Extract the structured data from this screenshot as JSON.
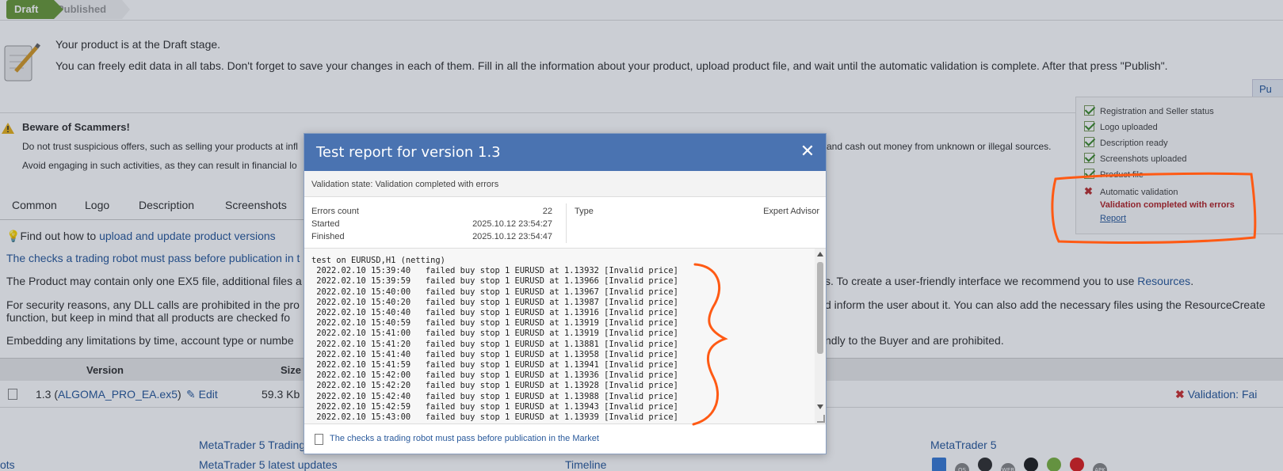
{
  "stages": {
    "draft": "Draft",
    "published": "Published"
  },
  "info": {
    "line1": "Your product is at the Draft stage.",
    "line2": "You can freely edit data in all tabs. Don't forget to save your changes in each of them. Fill in all the information about your product, upload product file, and wait until the automatic validation is complete. After that press \"Publish\"."
  },
  "publish_button": "Pu",
  "checklist": {
    "items": [
      "Registration and Seller status",
      "Logo uploaded",
      "Description ready",
      "Screenshots uploaded",
      "Product file"
    ],
    "auto_validation": "Automatic validation",
    "validation_error": "Validation completed with errors",
    "report_link": "Report"
  },
  "scam": {
    "title": "Beware of Scammers!",
    "line1": "Do not trust suspicious offers, such as selling your products at infl",
    "line1_tail": "and cash out money from unknown or illegal sources.",
    "line2": "Avoid engaging in such activities, as they can result in financial lo"
  },
  "tabs": [
    "Common",
    "Logo",
    "Description",
    "Screenshots"
  ],
  "content": {
    "hint_prefix": "Find out how to ",
    "hint_link": "upload and update product versions",
    "checks_link": "The checks a trading robot must pass before publication in t",
    "p1": "The Product may contain only one EX5 file, additional files a",
    "p1_tail_text": "s. To create a user-friendly interface we recommend you to use ",
    "p1_tail_link": "Resources",
    "p2": "For security reasons, any DLL calls are prohibited in the pro",
    "p2_tail": "d inform the user about it. You can also add the necessary files using the ResourceCreate",
    "p2_line2": "function, but keep in mind that all products are checked fo",
    "p3": "Embedding any limitations by time, account type or numbe",
    "p3_tail": "ndly to the Buyer and are prohibited."
  },
  "version_table": {
    "header_version": "Version",
    "header_size": "Size",
    "row": {
      "version": "1.3",
      "file": "ALGOMA_PRO_EA.ex5",
      "edit": "Edit",
      "size": "59.3 Kb",
      "validation": "Validation: Fai"
    }
  },
  "footer": {
    "link1": "MetaTrader 5 Trading",
    "link2": "MetaTrader 5 latest updates",
    "link3": "ots",
    "timeline": "Timeline",
    "mt5": "MetaTrader 5",
    "platforms": [
      "windows-icon",
      "macos-icon",
      "linux-icon",
      "web-icon",
      "apple-icon",
      "android-icon",
      "huawei-icon",
      "apk-icon"
    ],
    "platform_labels": [
      "",
      "OS",
      "",
      "WEB",
      "",
      "",
      "",
      "APK"
    ]
  },
  "modal": {
    "title": "Test report for version 1.3",
    "validation_state": "Validation state: Validation completed with errors",
    "errors_count_label": "Errors count",
    "errors_count": "22",
    "started_label": "Started",
    "started": "2025.10.12 23:54:27",
    "finished_label": "Finished",
    "finished": "2025.10.12 23:54:47",
    "type_label": "Type",
    "type_value": "Expert Advisor",
    "log": "test on EURUSD,H1 (netting)\n 2022.02.10 15:39:40   failed buy stop 1 EURUSD at 1.13932 [Invalid price]\n 2022.02.10 15:39:59   failed buy stop 1 EURUSD at 1.13966 [Invalid price]\n 2022.02.10 15:40:00   failed buy stop 1 EURUSD at 1.13967 [Invalid price]\n 2022.02.10 15:40:20   failed buy stop 1 EURUSD at 1.13987 [Invalid price]\n 2022.02.10 15:40:40   failed buy stop 1 EURUSD at 1.13916 [Invalid price]\n 2022.02.10 15:40:59   failed buy stop 1 EURUSD at 1.13919 [Invalid price]\n 2022.02.10 15:41:00   failed buy stop 1 EURUSD at 1.13919 [Invalid price]\n 2022.02.10 15:41:20   failed buy stop 1 EURUSD at 1.13881 [Invalid price]\n 2022.02.10 15:41:40   failed buy stop 1 EURUSD at 1.13958 [Invalid price]\n 2022.02.10 15:41:59   failed buy stop 1 EURUSD at 1.13941 [Invalid price]\n 2022.02.10 15:42:00   failed buy stop 1 EURUSD at 1.13936 [Invalid price]\n 2022.02.10 15:42:20   failed buy stop 1 EURUSD at 1.13928 [Invalid price]\n 2022.02.10 15:42:40   failed buy stop 1 EURUSD at 1.13988 [Invalid price]\n 2022.02.10 15:42:59   failed buy stop 1 EURUSD at 1.13943 [Invalid price]\n 2022.02.10 15:43:00   failed buy stop 1 EURUSD at 1.13939 [Invalid price]",
    "footer_link": "The checks a trading robot must pass before publication in the Market"
  },
  "colors": {
    "accent": "#4a73b1",
    "draft": "#6b9a3a",
    "error": "#b3262a",
    "annotation": "#ff5a14"
  }
}
